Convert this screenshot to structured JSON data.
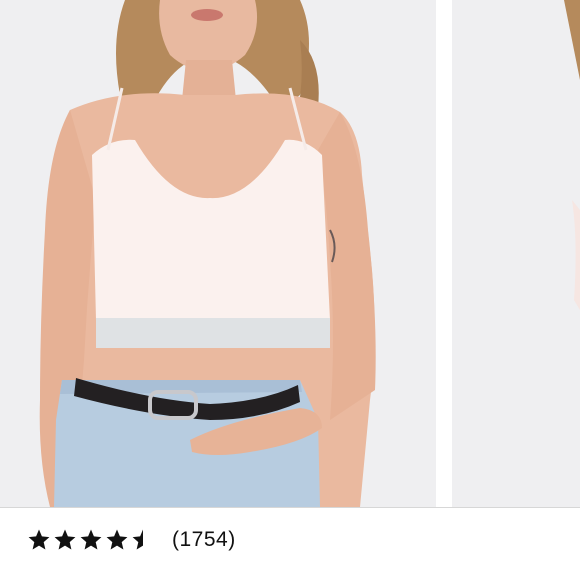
{
  "product": {
    "main_image": {
      "icon": "product-photo-crop-top-model"
    },
    "next_image": {
      "icon": "product-photo-next-partial"
    }
  },
  "rating": {
    "value": 4.5,
    "max": 5,
    "count_label": "(1754)",
    "star_color": "#111111"
  }
}
